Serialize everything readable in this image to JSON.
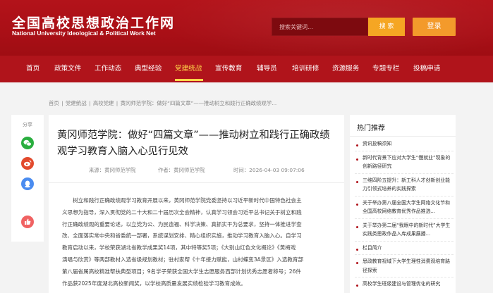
{
  "header": {
    "logo_cn": "全国高校思想政治工作网",
    "logo_en": "National University Ideological & Political Work Net",
    "search_placeholder": "搜索关键词...",
    "search_label": "搜 索",
    "login_label": "登录"
  },
  "nav": {
    "items": [
      {
        "label": "首页"
      },
      {
        "label": "政策文件"
      },
      {
        "label": "工作动态"
      },
      {
        "label": "典型经验"
      },
      {
        "label": "党建统战"
      },
      {
        "label": "宣传教育"
      },
      {
        "label": "辅导员"
      },
      {
        "label": "培训研修"
      },
      {
        "label": "资源服务"
      },
      {
        "label": "专题专栏"
      },
      {
        "label": "投稿申请"
      }
    ],
    "active": "党建统战"
  },
  "breadcrumb": {
    "home": "首页",
    "sep": "|",
    "c1": "党建统战",
    "c2": "高校党建",
    "c3": "黄冈师范学院：做好“四篇文章”——推动树立和践行正确政绩观学..."
  },
  "share": {
    "label": "分享"
  },
  "article": {
    "title": "黄冈师范学院：做好“四篇文章”——推动树立和践行正确政绩观学习教育入脑入心见行见效",
    "source": "来源：黄冈师范学院",
    "author": "作者：黄冈师范学院",
    "time": "时间：2026-04-03 09:07:06",
    "lines": [
      "　　树立和践行正确政绩观学习教育开展以来，黄冈师范学院党委坚持以习近平新时代中国特色社会主",
      "义思想为指导，深入贯彻党的二十大和二十届历次全会精神，认真学习领会习近平总书记关于树立和践",
      "行正确政绩观的重要论述，以立党为公、为民造福、科学决策、真抓实干为总要求，坚持一体推进学查",
      "改、全面落实常中央和省委统一部署，系统谋划安排、精心组织实施，推动学习教育入脑入心。自学习",
      "教育启动以来，学校荣获湖北省教学成果奖14项，其中特等奖5项；《大别山红色文化概论》《黄梅戏",
      "演唱与欣赏》等两部教材入选省级规划教材；驻村家帮《十年接力赋能，山村蝶变3A景区》入选教育部",
      "第八届省属高校精准帮扶典型项目；9名学子荣获全国大学生志愿服务西部计划优秀志愿者称号；26件",
      "作品获2025年度湖北高校新闻奖，以学校高质量发展实绩检验学习教育成效。"
    ]
  },
  "hot": {
    "title": "热门推荐",
    "items": [
      {
        "text": "资讯投稿须知",
        "sep": true
      },
      {
        "text": "新时代背景下应对大学生“慢就业”现象的创新路径研究",
        "sep": true
      },
      {
        "text": "三维四阶五提升：新工科人才创新创业能力引领式培养的实践探索",
        "sep": true
      },
      {
        "text": "关于举办第八届全国大学生网络文化节和全国高校网络教育优秀作品推选...",
        "sep": true
      },
      {
        "text": "关于举办第二届“我眼中的新时代”大学生实践类思政作品入库成果展播...",
        "sep": true
      },
      {
        "text": "栏目简介",
        "sep": true
      },
      {
        "text": "思政教育视域下大学生理性消费观培育路径探索",
        "sep": true
      },
      {
        "text": "高校学生班级建设与管理优化的研究",
        "sep": false
      }
    ]
  },
  "colors": {
    "brand_red": "#b0141b",
    "accent_orange": "#f39a2b",
    "active_nav": "#ffd54a",
    "wechat_green": "#2aae3f",
    "weibo_red": "#e24a2d",
    "qq_blue": "#4a8cf0",
    "like_pink": "#f06262"
  },
  "icons": {
    "wechat": "wechat-icon",
    "weibo": "weibo-icon",
    "qq": "qq-icon",
    "like": "thumbs-up-icon"
  }
}
